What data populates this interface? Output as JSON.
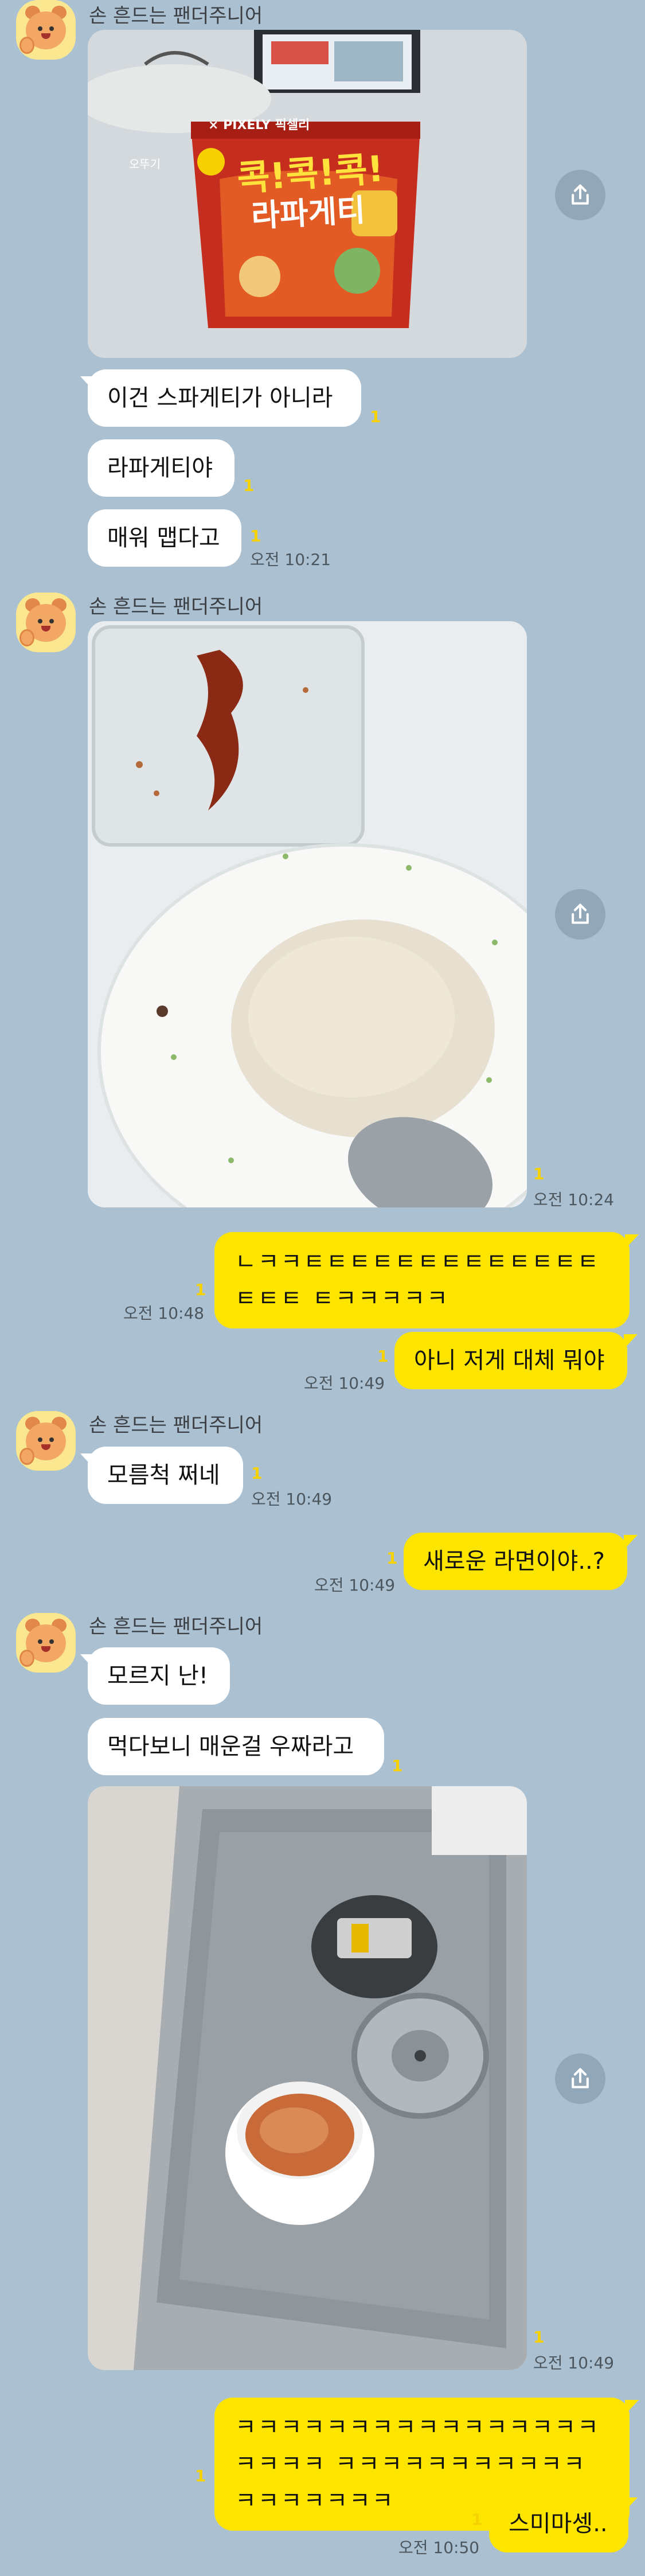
{
  "sender_name": "손 흔드는 팬더주니어",
  "icons": {
    "avatar": "panda-junior-avatar",
    "share": "share-icon"
  },
  "colors": {
    "background": "#abc1d1",
    "incoming_bubble": "#ffffff",
    "outgoing_bubble": "#fee500",
    "unread": "#f6d200"
  },
  "unread_mark": "1",
  "photo_cup_text": {
    "brand": "오뚜기",
    "collab": "× PIXELY 픽셀리",
    "headline": "콕!콕!콕!",
    "product": "라파게티"
  },
  "messages": {
    "g1_text1": "이건 스파게티가 아니라",
    "g1_text2": "라파게티야",
    "g1_text3": "매워 맵다고",
    "g1_time": "오전 10:21",
    "g2_time": "오전 10:24",
    "out1_text": "ㄴㅋㅋㅌㅌㅌㅌㅌㅌㅌㅌㅌㅌㅌㅌㅌㅌㅌㅌ ㅌㅋㅋㅋㅋㅋ",
    "out1_time": "오전 10:48",
    "out2_text": "아니 저게 대체 뭐야",
    "out2_time": "오전 10:49",
    "g3_text": "모름척 쩌네",
    "g3_time": "오전 10:49",
    "out3_text": "새로운 라면이야..?",
    "out3_time": "오전 10:49",
    "g4_text1": "모르지 난!",
    "g4_text2": "먹다보니 매운걸 우짜라고",
    "g4_time": "오전 10:49",
    "out4_text": "ㅋㅋㅋㅋㅋㅋㅋㅋㅋㅋㅋㅋㅋㅋㅋㅋㅋㅋㅋㅋ ㅋㅋㅋㅋㅋㅋㅋㅋㅋㅋㅋㅋㅋㅋㅋㅋㅋㅋ",
    "out5_text": "스미마셍..",
    "out5_time": "오전 10:50"
  }
}
